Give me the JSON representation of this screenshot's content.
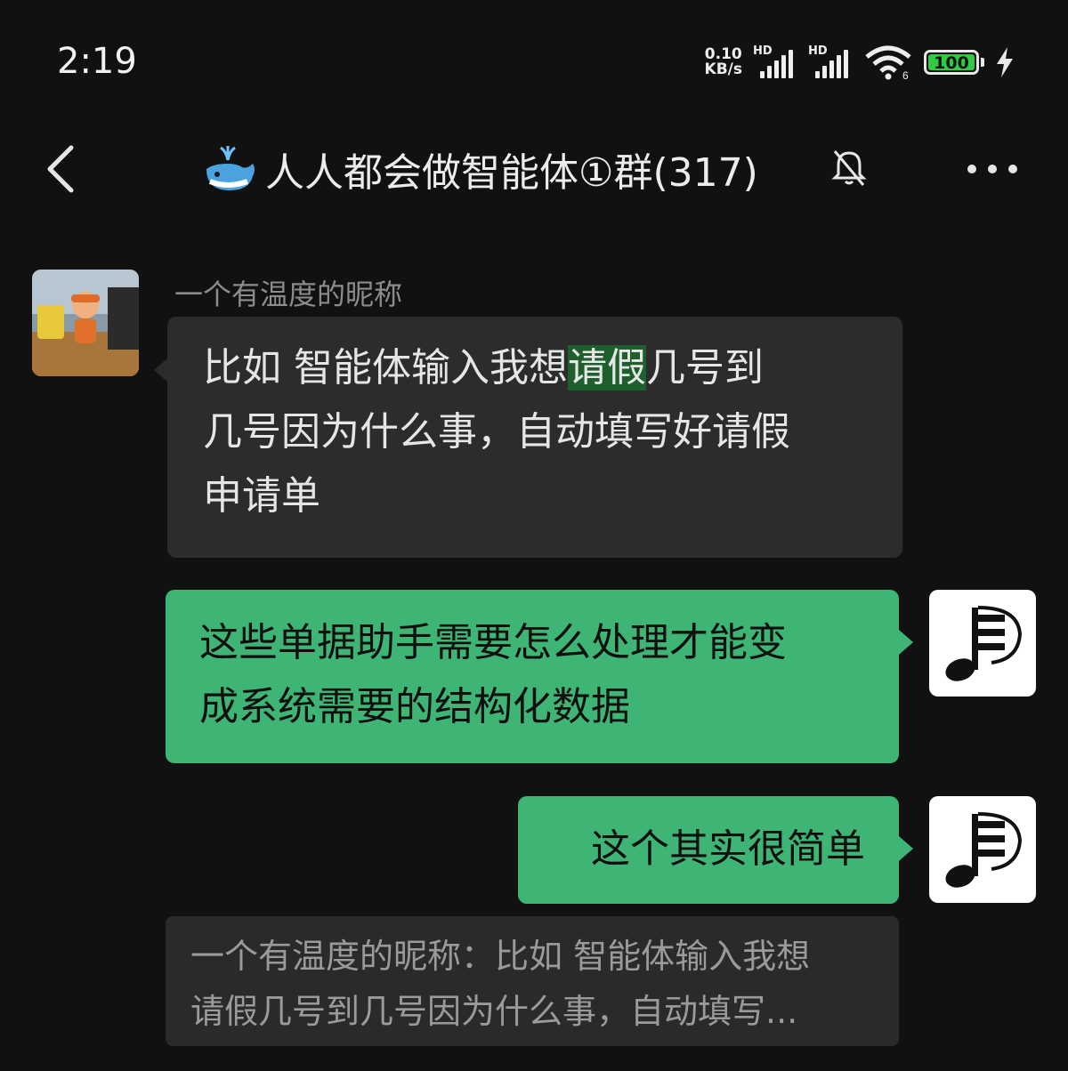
{
  "status_bar": {
    "time": "2:19",
    "net_speed_value": "0.10",
    "net_speed_unit": "KB/s",
    "hd_label_1": "HD",
    "hd_label_2": "HD",
    "wifi_badge": "6",
    "battery": "100",
    "charging": true
  },
  "header": {
    "title_icon": "whale-icon",
    "title": "人人都会做智能体①群(317)",
    "muted": true
  },
  "messages": [
    {
      "direction": "incoming",
      "sender": "一个有温度的昵称",
      "line1_before": "比如 智能体输入我想",
      "line1_highlight": "请假",
      "line1_after": "几号到",
      "line2": "几号因为什么事，自动填写好请假",
      "line3": "申请单"
    },
    {
      "direction": "outgoing",
      "line1": "这些单据助手需要怎么处理才能变",
      "line2": "成系统需要的结构化数据"
    },
    {
      "direction": "outgoing",
      "line1": "这个其实很简单"
    }
  ],
  "quote": {
    "line1": "一个有温度的昵称：比如 智能体输入我想",
    "line2": "请假几号到几号因为什么事，自动填写..."
  },
  "colors": {
    "background": "#111111",
    "incoming_bubble": "#2c2c2c",
    "outgoing_bubble": "#3eb575",
    "highlight": "#1f5f2e"
  }
}
